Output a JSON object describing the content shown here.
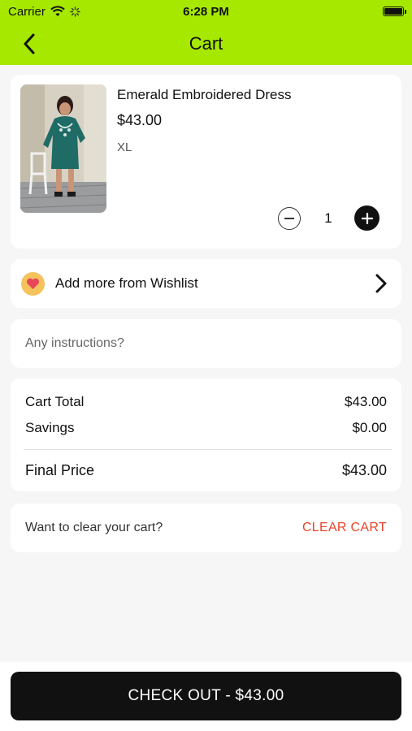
{
  "status_bar": {
    "carrier": "Carrier",
    "time": "6:28 PM",
    "battery_level": 1.0
  },
  "nav": {
    "title": "Cart",
    "back_icon": "chevron-left-icon"
  },
  "cart_item": {
    "name": "Emerald Embroidered Dress",
    "price": "$43.00",
    "size": "XL",
    "quantity": "1"
  },
  "wishlist": {
    "label": "Add more from Wishlist",
    "icon": "heart-icon"
  },
  "instructions": {
    "placeholder": "Any instructions?",
    "value": ""
  },
  "totals": {
    "cart_total_label": "Cart Total",
    "cart_total_value": "$43.00",
    "savings_label": "Savings",
    "savings_value": "$0.00",
    "final_price_label": "Final Price",
    "final_price_value": "$43.00"
  },
  "clear": {
    "prompt": "Want to clear your cart?",
    "button_label": "CLEAR CART"
  },
  "checkout": {
    "label": "CHECK OUT - $43.00"
  },
  "colors": {
    "brand": "#a6e800",
    "danger": "#e8442c",
    "primary_button": "#111111",
    "heart_badge": "#f4c35c",
    "heart": "#e8475a"
  }
}
